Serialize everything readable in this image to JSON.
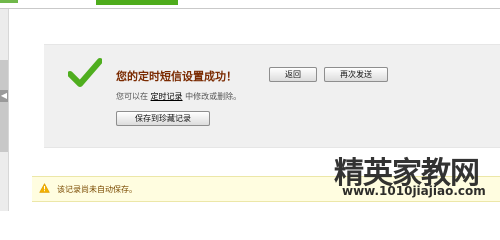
{
  "success": {
    "title": "您的定时短信设置成功！",
    "back_button": "返回",
    "resend_button": "再次发送",
    "hint_prefix": "您可以在",
    "hint_link": "定时记录",
    "hint_suffix": "中修改或删除。",
    "save_button": "保存到珍藏记录"
  },
  "notice": {
    "text": "该记录尚未自动保存。"
  },
  "watermark": {
    "title": "精英家教网",
    "url": "www.1010jiajiao.com"
  },
  "colors": {
    "success_check": "#4fae1f",
    "success_title": "#7a2a00",
    "notice_bg": "#fffde0",
    "warning_icon": "#f2b000"
  }
}
